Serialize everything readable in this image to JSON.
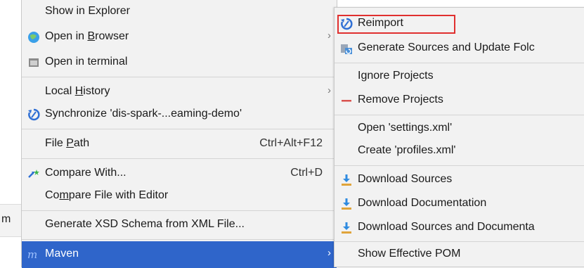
{
  "background": {
    "editor_text": "m"
  },
  "main_menu": {
    "items": [
      {
        "label": "Show in Explorer"
      },
      {
        "label_pre": "Open in ",
        "label_u": "B",
        "label_post": "rowser",
        "icon": "globe-icon"
      },
      {
        "label": "Open in terminal",
        "icon": "terminal-icon"
      },
      {
        "label_pre": "Local ",
        "label_u": "H",
        "label_post": "istory"
      },
      {
        "label": "Synchronize 'dis-spark-...eaming-demo'",
        "icon": "sync-icon"
      },
      {
        "label_pre": "File ",
        "label_u": "P",
        "label_post": "ath",
        "shortcut": "Ctrl+Alt+F12"
      },
      {
        "label": "Compare With...",
        "shortcut": "Ctrl+D",
        "icon": "compare-icon"
      },
      {
        "label_pre": "Co",
        "label_u": "m",
        "label_post": "pare File with Editor"
      },
      {
        "label": "Generate XSD Schema from XML File..."
      },
      {
        "label": "Maven",
        "icon": "maven-icon"
      }
    ]
  },
  "sub_menu": {
    "items": [
      {
        "label": "Reimport",
        "icon": "reimport-icon"
      },
      {
        "label": "Generate Sources and Update Folc",
        "icon": "generate-sources-icon"
      },
      {
        "label": "Ignore Projects"
      },
      {
        "label": "Remove Projects",
        "icon": "remove-icon"
      },
      {
        "label": "Open 'settings.xml'"
      },
      {
        "label": "Create 'profiles.xml'"
      },
      {
        "label": "Download Sources",
        "icon": "download-icon"
      },
      {
        "label": "Download Documentation",
        "icon": "download-icon"
      },
      {
        "label": "Download Sources and Documenta",
        "icon": "download-icon"
      },
      {
        "label": "Show Effective POM"
      }
    ]
  },
  "colors": {
    "selected": "#2f65ca",
    "highlight_box": "#e0302f",
    "menu_bg": "#f2f2f2"
  }
}
